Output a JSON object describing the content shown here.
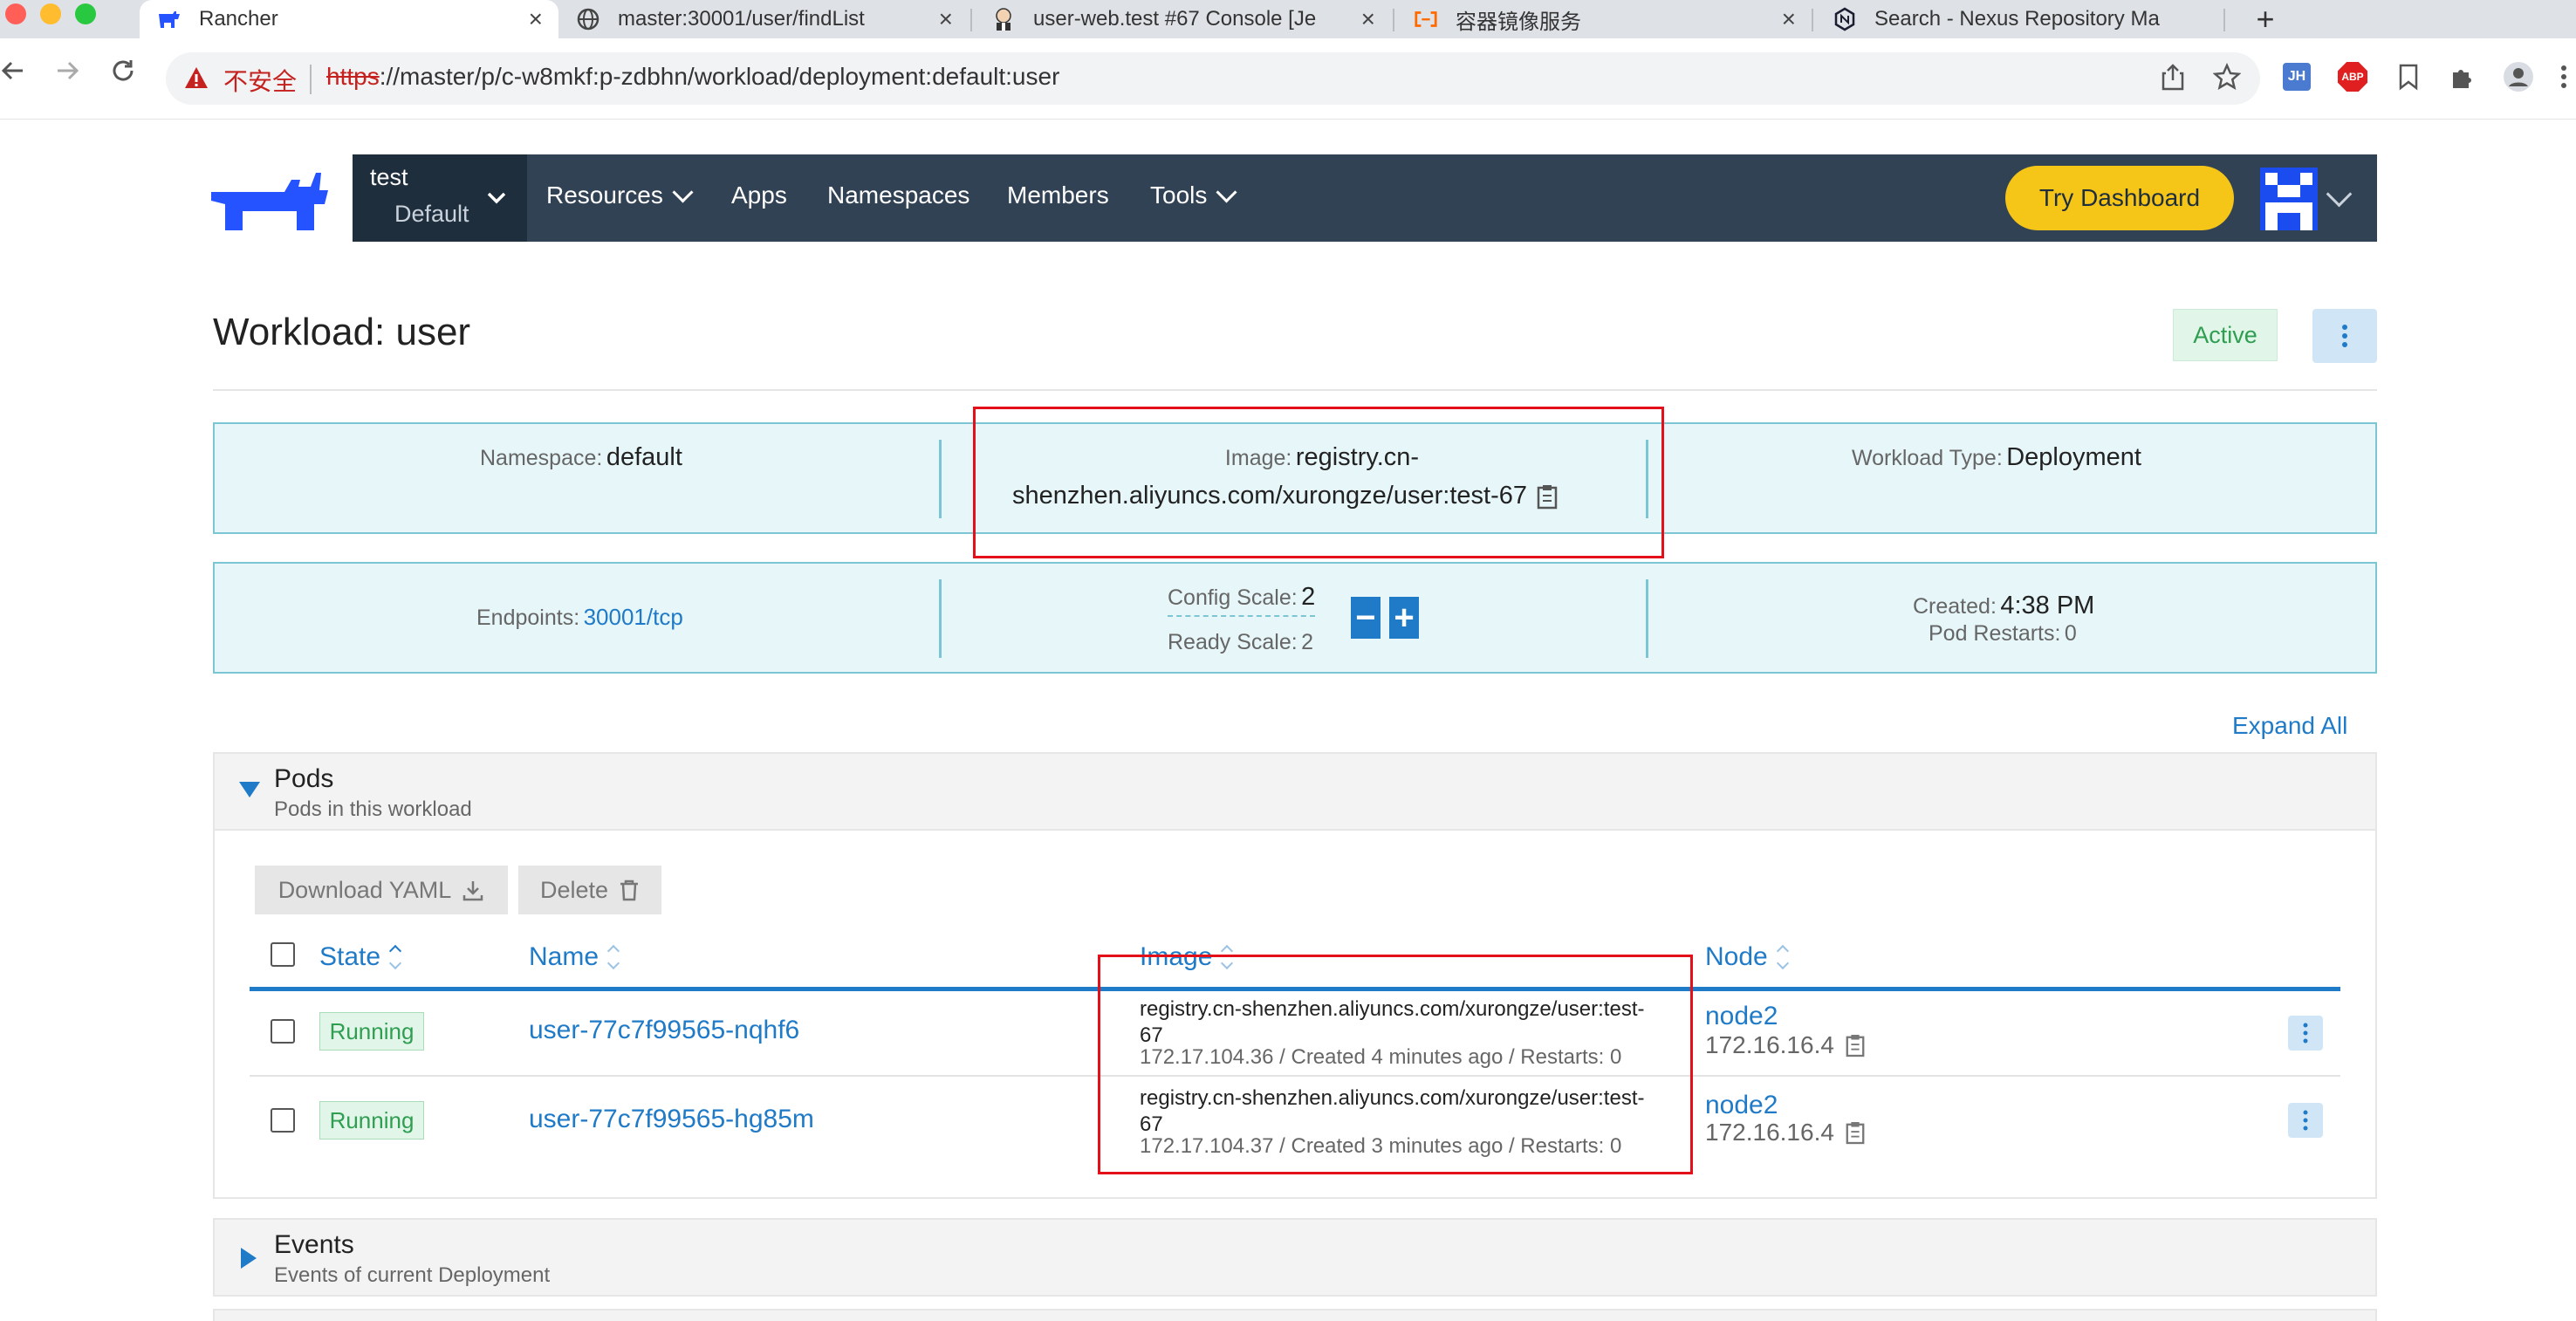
{
  "browser": {
    "tabs": [
      {
        "title": "Rancher",
        "active": true
      },
      {
        "title": "master:30001/user/findList",
        "active": false
      },
      {
        "title": "user-web.test #67 Console [Je",
        "active": false
      },
      {
        "title": "容器镜像服务",
        "active": false
      },
      {
        "title": "Search - Nexus Repository Ma",
        "active": false
      }
    ],
    "new_tab": "+",
    "security_label": "不安全",
    "url_scheme": "https",
    "url_rest": "://master/p/c-w8mkf:p-zdbhn/workload/deployment:default:user",
    "extensions": [
      "JH",
      "ABP"
    ]
  },
  "colors": {
    "header_bg": "#314255",
    "accent": "#1f7ac7",
    "try_dashboard": "#f5c518",
    "active_green": "#2f9e51",
    "info_bg": "#e6f6f9",
    "highlight_red": "#e3101a"
  },
  "header": {
    "cluster": "test",
    "project": "Default",
    "nav": [
      "Resources",
      "Apps",
      "Namespaces",
      "Members",
      "Tools"
    ],
    "try_dashboard": "Try Dashboard"
  },
  "workload": {
    "title": "Workload: user",
    "state": "Active",
    "namespace_label": "Namespace:",
    "namespace": "default",
    "image_label": "Image:",
    "image_line1": "registry.cn-",
    "image_line2": "shenzhen.aliyuncs.com/xurongze/user:test-67",
    "type_label": "Workload Type:",
    "type": "Deployment",
    "endpoints_label": "Endpoints:",
    "endpoints": "30001/tcp",
    "config_scale_label": "Config Scale:",
    "config_scale": "2",
    "ready_scale_label": "Ready Scale:",
    "ready_scale": "2",
    "created_label": "Created:",
    "created": "4:38 PM",
    "pod_restarts_label": "Pod Restarts:",
    "pod_restarts": "0",
    "minus": "−",
    "plus": "+"
  },
  "expand_all": "Expand All",
  "pods": {
    "title": "Pods",
    "subtitle": "Pods in this workload",
    "download_yaml": "Download YAML",
    "delete": "Delete",
    "columns": {
      "state": "State",
      "name": "Name",
      "image": "Image",
      "node": "Node"
    },
    "rows": [
      {
        "state": "Running",
        "name": "user-77c7f99565-nqhf6",
        "image_line1": "registry.cn-shenzhen.aliyuncs.com/xurongze/user:test-",
        "image_line2": "67",
        "meta": "172.17.104.36 / Created 4 minutes ago / Restarts: 0",
        "node": "node2",
        "node_ip": "172.16.16.4"
      },
      {
        "state": "Running",
        "name": "user-77c7f99565-hg85m",
        "image_line1": "registry.cn-shenzhen.aliyuncs.com/xurongze/user:test-",
        "image_line2": "67",
        "meta": "172.17.104.37 / Created 3 minutes ago / Restarts: 0",
        "node": "node2",
        "node_ip": "172.16.16.4"
      }
    ]
  },
  "events": {
    "title": "Events",
    "subtitle": "Events of current Deployment"
  }
}
